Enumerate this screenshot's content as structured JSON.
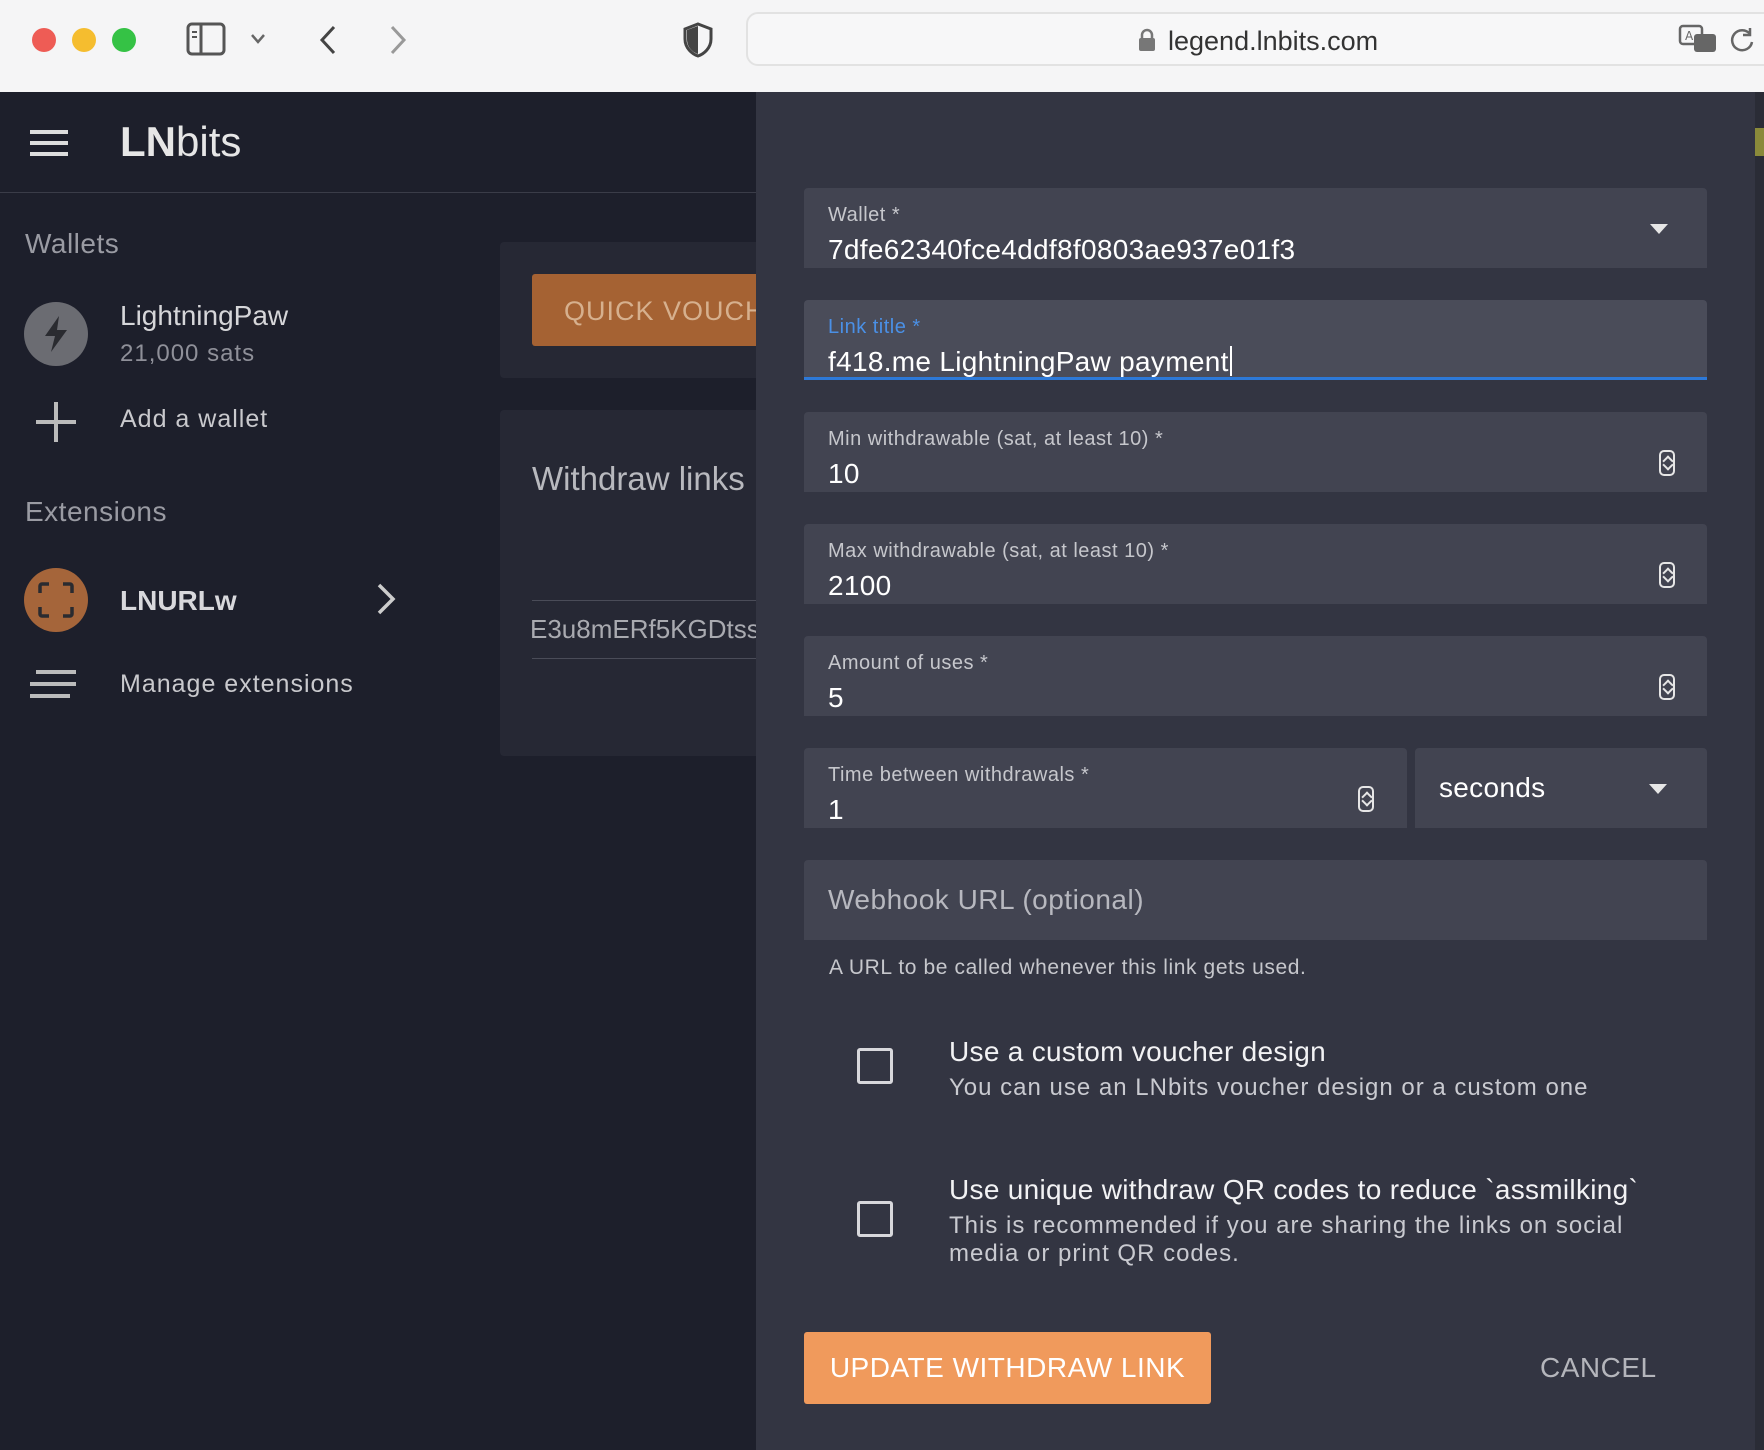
{
  "browser": {
    "url": "legend.lnbits.com"
  },
  "app": {
    "brand_strong": "LN",
    "brand_light": "bits"
  },
  "sidebar": {
    "wallets_title": "Wallets",
    "wallet": {
      "name": "LightningPaw",
      "balance": "21,000 sats"
    },
    "add_wallet": "Add a wallet",
    "extensions_title": "Extensions",
    "extension": {
      "name": "LNURLw"
    },
    "manage_extensions": "Manage extensions"
  },
  "background": {
    "quick_voucher": "QUICK VOUCH",
    "withdraw_links_title": "Withdraw links",
    "link_hash": "E3u8mERf5KGDtss"
  },
  "dialog": {
    "wallet": {
      "label": "Wallet *",
      "value": "7dfe62340fce4ddf8f0803ae937e01f3"
    },
    "link_title": {
      "label": "Link title *",
      "value": "f418.me LightningPaw payment"
    },
    "min_withdrawable": {
      "label": "Min withdrawable (sat, at least 10) *",
      "value": "10"
    },
    "max_withdrawable": {
      "label": "Max withdrawable (sat, at least 10) *",
      "value": "2100"
    },
    "uses": {
      "label": "Amount of uses *",
      "value": "5"
    },
    "wait_time": {
      "label": "Time between withdrawals *",
      "value": "1"
    },
    "wait_unit": {
      "value": "seconds"
    },
    "webhook": {
      "placeholder": "Webhook URL (optional)",
      "hint": "A URL to be called whenever this link gets used."
    },
    "custom_design": {
      "title": "Use a custom voucher design",
      "subtitle": "You can use an LNbits voucher design or a custom one",
      "checked": false
    },
    "unique_codes": {
      "title": "Use unique withdraw QR codes to reduce `assmilking`",
      "subtitle": "This is recommended if you are sharing the links on social media or print QR codes.",
      "checked": false
    },
    "update_button": "UPDATE WITHDRAW LINK",
    "cancel_button": "CANCEL"
  },
  "colors": {
    "accent_orange": "#f09a5c",
    "focus_blue": "#2d79d8",
    "dialog_bg": "#333542",
    "page_bg": "#1d1f2b"
  }
}
